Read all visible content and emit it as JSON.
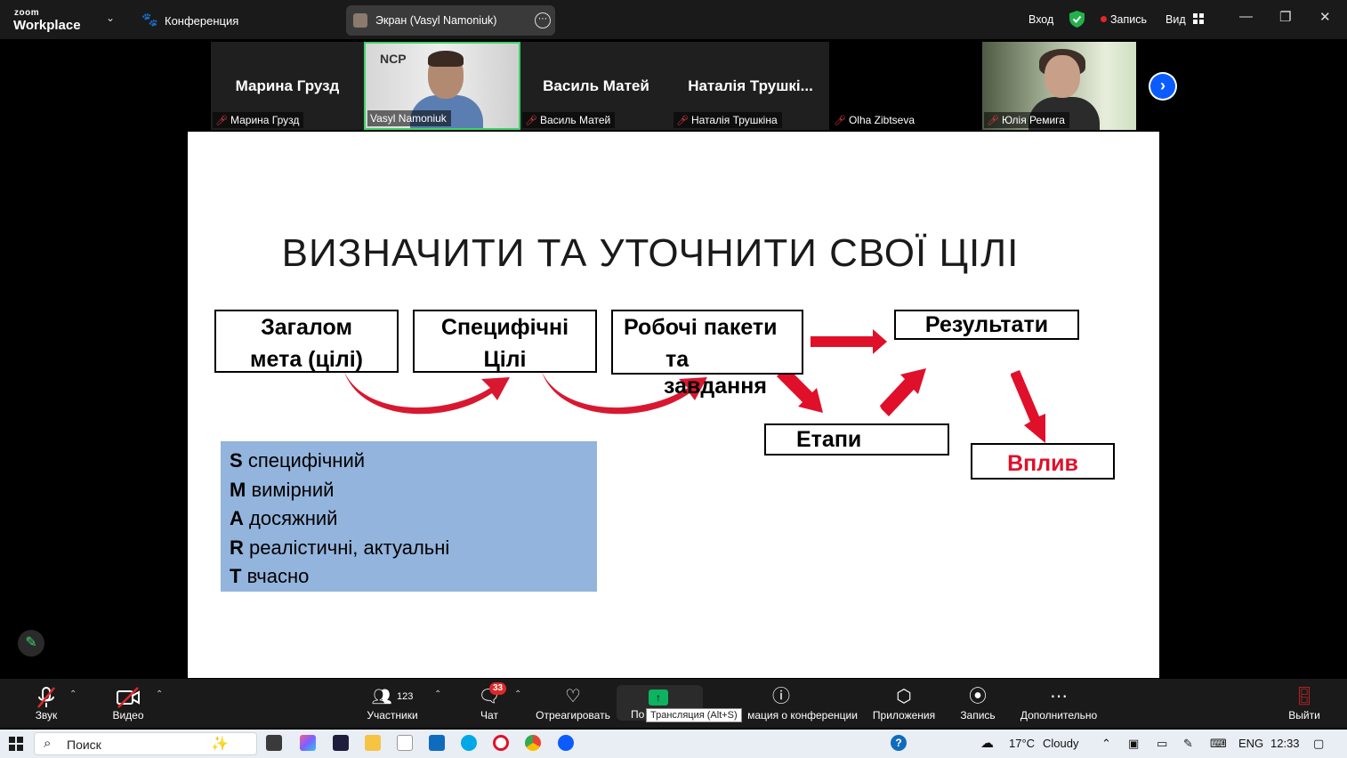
{
  "app": {
    "logo_small": "zoom",
    "logo_big": "Workplace",
    "meeting_menu_label": "Конференция",
    "screen_share_label": "Экран (Vasyl Namoniuk)",
    "signin_label": "Вход",
    "record_label": "Запись",
    "view_label": "Вид"
  },
  "participants": [
    {
      "display": "Марина Грузд",
      "label": "Марина Грузд"
    },
    {
      "display": "",
      "label": "Vasyl Namoniuk"
    },
    {
      "display": "Василь Матей",
      "label": "Василь Матей"
    },
    {
      "display": "Наталія Трушкі...",
      "label": "Наталія Трушкіна"
    },
    {
      "display": "",
      "label": "Olha Zibtseva"
    },
    {
      "display": "",
      "label": "Юлія Ремига"
    }
  ],
  "video_logo_text": "NCP",
  "slide": {
    "title": "ВИЗНАЧИТИ ТА УТОЧНИТИ СВОЇ ЦІЛІ",
    "box_goal_line1": "Загалом",
    "box_goal_line2": "мета (цілі)",
    "box_specific_line1": "Специфічні",
    "box_specific_line2": "Цілі",
    "box_workpackages_line1": "Робочі пакети",
    "box_workpackages_line2": "та",
    "box_workpackages_overflow": "завдання",
    "box_results": "Результати",
    "box_stages": "Етапи",
    "box_impact": "Вплив",
    "smart": [
      {
        "letter": "S",
        "text": "специфічний"
      },
      {
        "letter": "M",
        "text": "вимірний"
      },
      {
        "letter": "A",
        "text": "досяжний"
      },
      {
        "letter": "R",
        "text": "реалістичні, актуальні"
      },
      {
        "letter": "T",
        "text": "вчасно"
      }
    ],
    "accent_color": "#e0102a",
    "smart_bg": "#93b4dc"
  },
  "toolbar": {
    "audio": "Звук",
    "video": "Видео",
    "participants": "Участники",
    "participants_count": "123",
    "chat": "Чат",
    "chat_badge": "33",
    "react": "Отреагировать",
    "share_partial": "По",
    "share_tooltip": "Трансляция (Alt+S)",
    "info_partial": "мация о конференции",
    "apps": "Приложения",
    "record": "Запись",
    "more": "Дополнительно",
    "leave": "Выйти"
  },
  "taskbar": {
    "search_placeholder": "Поиск",
    "weather_temp": "17°C",
    "weather_desc": "Cloudy",
    "language": "ENG",
    "time": "12:33"
  }
}
